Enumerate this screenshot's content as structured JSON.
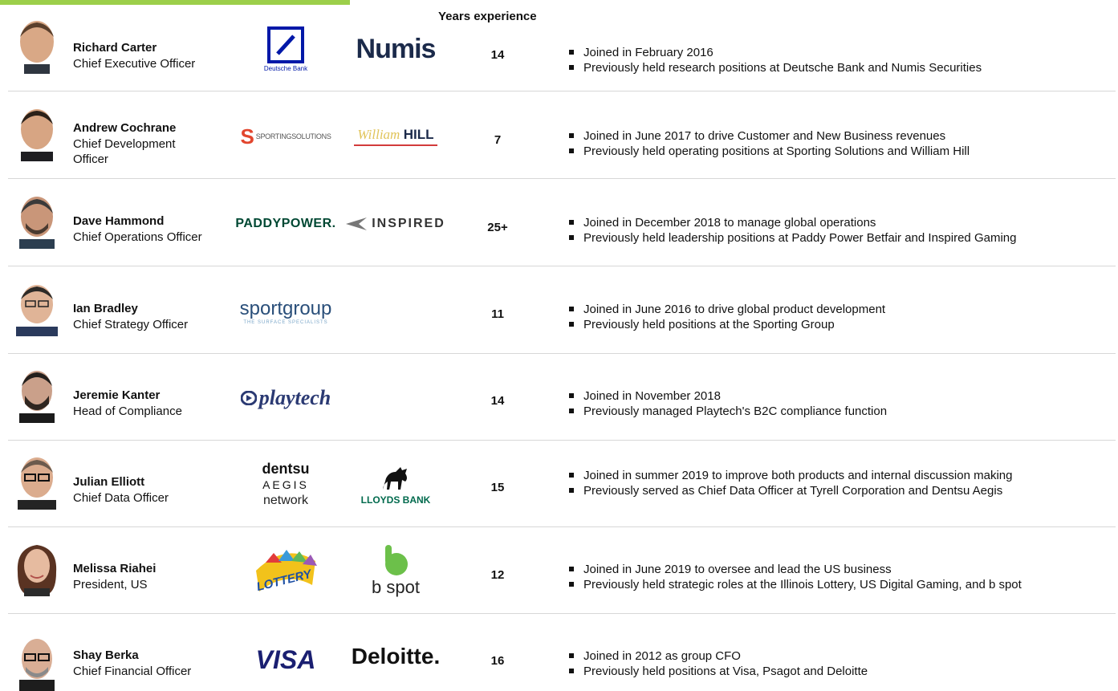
{
  "header": {
    "years_label": "Years experience"
  },
  "people": [
    {
      "name": "Richard Carter",
      "title": "Chief Executive Officer",
      "years": "14",
      "logos": {
        "logo1_text": "Deutsche Bank",
        "logo2_text": "Numis"
      },
      "bullets": [
        "Joined in February 2016",
        "Previously held research positions at Deutsche Bank and Numis  Securities"
      ]
    },
    {
      "name": "Andrew Cochrane",
      "title": "Chief Development Officer",
      "years": "7",
      "logos": {
        "logo1_text": "SPORTINGSOLUTIONS",
        "logo2_text_a": "William",
        "logo2_text_b": "HILL"
      },
      "bullets": [
        "Joined in June 2017 to drive Customer and New Business revenues",
        "Previously held operating positions at Sporting Solutions and William  Hill"
      ]
    },
    {
      "name": "Dave Hammond",
      "title": "Chief Operations Officer",
      "years": "25+",
      "logos": {
        "logo1_text": "PADDYPOWER.",
        "logo2_text": "INSPIRED"
      },
      "bullets": [
        "Joined in December 2018 to manage global operations",
        "Previously held leadership positions at Paddy  Power Betfair and Inspired Gaming"
      ]
    },
    {
      "name": "Ian Bradley",
      "title": "Chief Strategy Officer",
      "years": "11",
      "logos": {
        "logo1_text": "sportgroup",
        "logo1_sub": "THE SURFACE SPECIALISTS"
      },
      "bullets": [
        "Joined in June 2016 to drive global product development",
        "Previously held positions at the Sporting Group"
      ]
    },
    {
      "name": "Jeremie Kanter",
      "title": "Head of Compliance",
      "years": "14",
      "logos": {
        "logo1_text": "playtech"
      },
      "bullets": [
        "Joined in November 2018",
        "Previously managed Playtech's B2C compliance function"
      ]
    },
    {
      "name": "Julian Elliott",
      "title": "Chief Data Officer",
      "years": "15",
      "logos": {
        "logo1_line1": "dentsu",
        "logo1_line2": "AEGIS",
        "logo1_line3": "network",
        "logo2_text": "LLOYDS BANK"
      },
      "bullets": [
        "Joined in summer 2019 to improve both products and internal discussion making",
        "Previously served as Chief Data Officer at Tyrell Corporation and Dentsu Aegis"
      ]
    },
    {
      "name": "Melissa Riahei",
      "title": "President, US",
      "years": "12",
      "logos": {
        "logo1_text": "LOTTERY",
        "logo2_text": "b spot"
      },
      "bullets": [
        "Joined in June 2019 to oversee and lead the US business",
        "Previously held strategic roles at the Illinois  Lottery, US Digital Gaming,  and b spot"
      ]
    },
    {
      "name": "Shay Berka",
      "title": "Chief Financial Officer",
      "years": "16",
      "logos": {
        "logo1_text": "VISA",
        "logo2_text": "Deloitte."
      },
      "bullets": [
        "Joined in 2012 as group CFO",
        "Previously held positions at Visa, Psagot and Deloitte"
      ]
    }
  ],
  "colors": {
    "accent_green": "#9ccf4a",
    "deutsche_blue": "#0018a8",
    "numis_navy": "#1b2a4a",
    "paddy_green": "#004833",
    "visa_blue": "#1a1f71",
    "lloyds_green": "#006a4d"
  }
}
